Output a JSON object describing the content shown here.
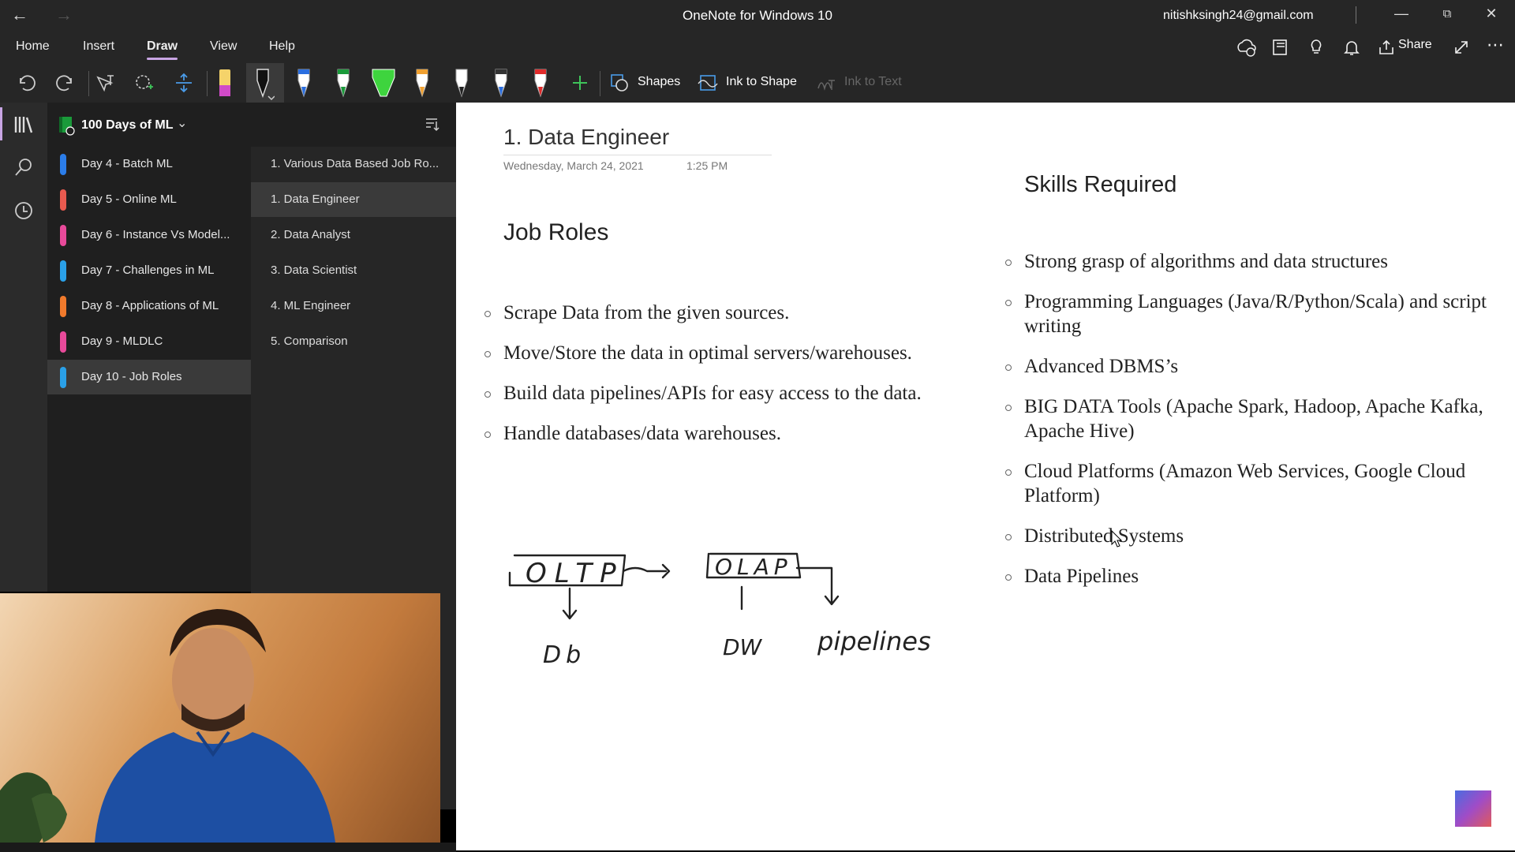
{
  "window": {
    "title": "OneNote for Windows 10",
    "account": "nitishksingh24@gmail.com"
  },
  "menu": {
    "tabs": [
      "Home",
      "Insert",
      "Draw",
      "View",
      "Help"
    ],
    "active": "Draw",
    "share_label": "Share"
  },
  "toolbar": {
    "shapes_label": "Shapes",
    "ink_to_shape_label": "Ink to Shape",
    "ink_to_text_label": "Ink to Text"
  },
  "notebook": {
    "name": "100 Days of ML",
    "sections": [
      {
        "label": "Day 4 - Batch ML",
        "color": "#2b7de9"
      },
      {
        "label": "Day 5 - Online ML",
        "color": "#e85a4f"
      },
      {
        "label": "Day 6 - Instance Vs Model...",
        "color": "#e84a9a"
      },
      {
        "label": "Day 7 - Challenges in ML",
        "color": "#2aa0e8"
      },
      {
        "label": "Day 8 - Applications of ML",
        "color": "#f07a2c"
      },
      {
        "label": "Day 9 - MLDLC",
        "color": "#e84a9a"
      },
      {
        "label": "Day 10 - Job Roles",
        "color": "#2aa0e8"
      }
    ],
    "selected_section": "Day 10 - Job Roles"
  },
  "pages": {
    "items": [
      "1. Various Data Based Job Ro...",
      "1. Data Engineer",
      "2. Data Analyst",
      "3. Data Scientist",
      "4. ML Engineer",
      "5. Comparison"
    ],
    "selected": "1. Data Engineer"
  },
  "note": {
    "title": "1. Data Engineer",
    "date": "Wednesday, March 24, 2021",
    "time": "1:25 PM",
    "job_roles_heading": "Job Roles",
    "job_roles": [
      "Scrape Data from the given sources.",
      "Move/Store the data in optimal servers/warehouses.",
      "Build data pipelines/APIs for easy access to the data.",
      "Handle databases/data warehouses."
    ],
    "skills_heading": "Skills Required",
    "skills": [
      "Strong grasp of algorithms and data structures",
      "Programming Languages (Java/R/Python/Scala) and script writing",
      "Advanced DBMS’s",
      "BIG DATA Tools (Apache Spark, Hadoop, Apache Kafka, Apache Hive)",
      "Cloud Platforms (Amazon Web Services, Google Cloud Platform)",
      "Distributed Systems",
      "Data Pipelines"
    ],
    "ink": {
      "oltp": "OLTP",
      "olap": "OLAP",
      "db": "Db",
      "dw": "DW",
      "pipelines": "pipelines"
    }
  }
}
